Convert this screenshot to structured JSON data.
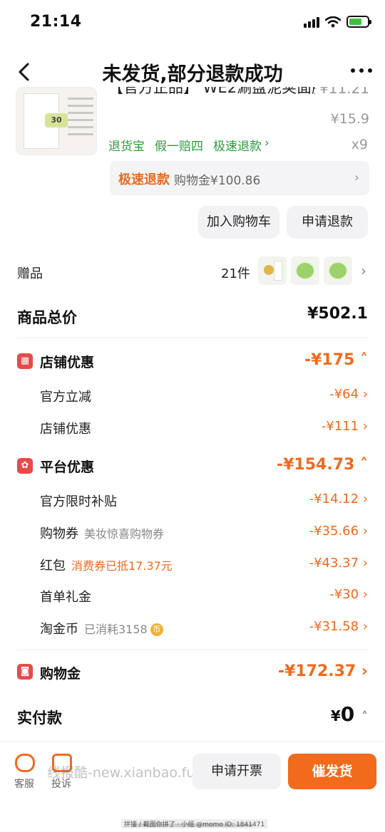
{
  "status_bar": {
    "time": "21:14"
  },
  "nav": {
    "title": "未发货,部分退款成功"
  },
  "product": {
    "title": "【官方正品】 WE2涮盘泥荚面膜",
    "price": "¥11.21",
    "original_price": "¥15.9",
    "quantity": "x9",
    "thumb_badge": "30",
    "service_tags": [
      "退货宝",
      "假一赔四",
      "极速退款"
    ],
    "service_chevron": "›",
    "refund_info": {
      "label": "极速退款",
      "value": "购物金¥100.86"
    },
    "buttons": {
      "add_to_cart": "加入购物车",
      "apply_refund": "申请退款"
    }
  },
  "gifts": {
    "label": "赠品",
    "count": "21件"
  },
  "summary": {
    "goods_total_label": "商品总价",
    "goods_total_value": "¥502.1",
    "store_discount": {
      "label": "店铺优惠",
      "value": "-¥175",
      "items": [
        {
          "label": "官方立减",
          "value": "-¥64"
        },
        {
          "label": "店铺优惠",
          "value": "-¥111"
        }
      ]
    },
    "platform_discount": {
      "label": "平台优惠",
      "value": "-¥154.73",
      "items": [
        {
          "label": "官方限时补贴",
          "sub": "",
          "value": "-¥14.12"
        },
        {
          "label": "购物券",
          "sub": "美妆惊喜购物券",
          "value": "-¥35.66"
        },
        {
          "label": "红包",
          "sub": "消费券已抵17.37元",
          "value": "-¥43.37"
        },
        {
          "label": "首单礼金",
          "sub": "",
          "value": "-¥30"
        },
        {
          "label": "淘金币",
          "sub": "已消耗3158",
          "value": "-¥31.58"
        }
      ]
    },
    "shopping_credit": {
      "label": "购物金",
      "value": "-¥172.37"
    },
    "paid": {
      "label": "实付款",
      "currency": "¥",
      "amount": "0"
    }
  },
  "bottom_bar": {
    "service_label": "客服",
    "complaint_label": "投诉",
    "invoice_button": "申请开票",
    "urge_button": "催发货"
  },
  "watermark": "线报酷-new.xianbao.fun",
  "footer_mark": "拼接 / 截图你拼了 · 小组 @momo ID: 1841471",
  "colors": {
    "accent_orange": "#f06a1e",
    "tag_green": "#2c9c3c",
    "icon_red": "#e84a4a"
  }
}
